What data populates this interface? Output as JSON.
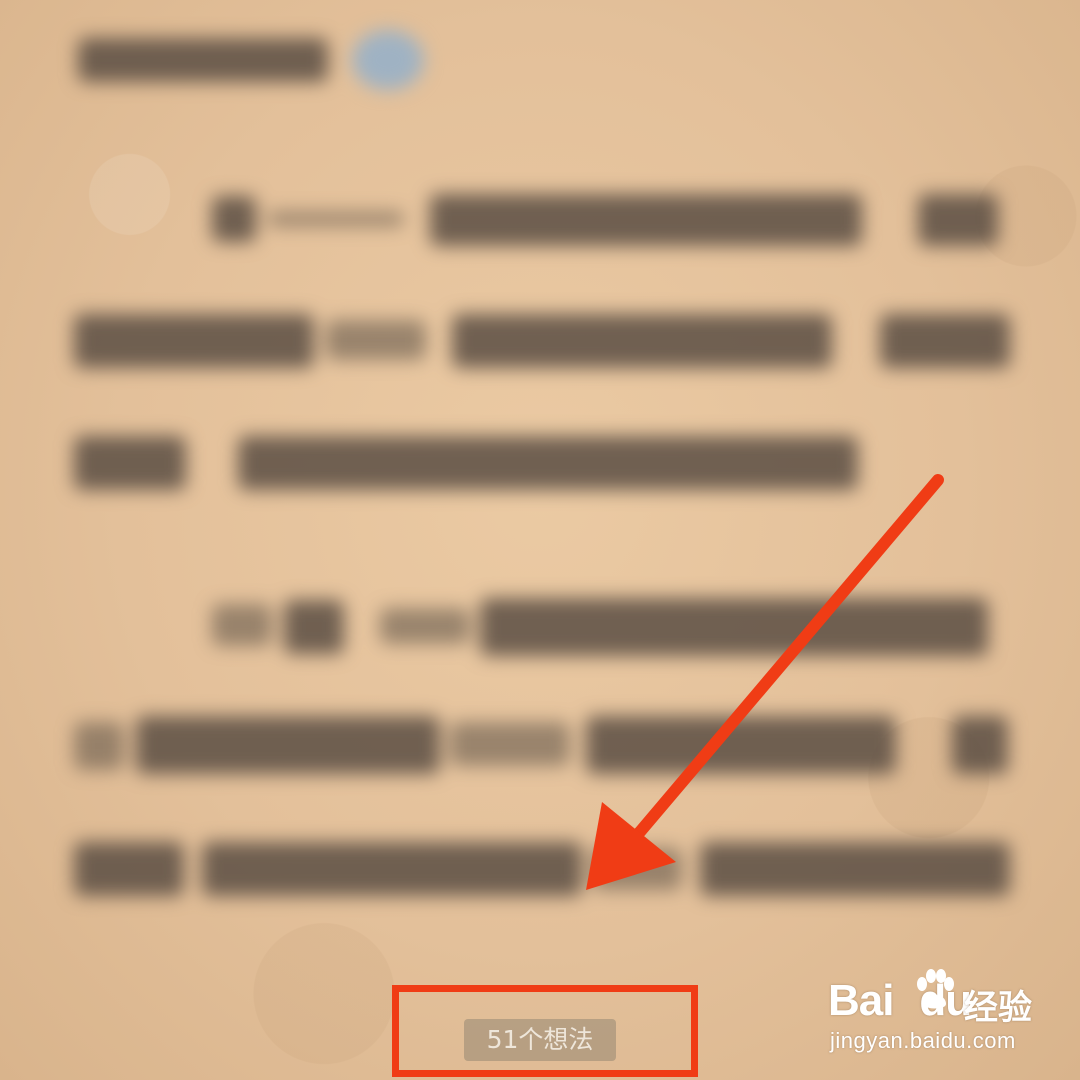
{
  "reader": {
    "thoughts_label": "51个想法"
  },
  "annotation": {
    "arrow_color": "#f03c15",
    "highlight_color": "#f03c15"
  },
  "watermark": {
    "brand_latin": "Bai",
    "brand_latin_tail": "du",
    "brand_cn": "经验",
    "url": "jingyan.baidu.com",
    "logo_icon": "paw-icon"
  },
  "colors": {
    "paper": "#e3c09a",
    "text_blur": "#5a4e43"
  }
}
